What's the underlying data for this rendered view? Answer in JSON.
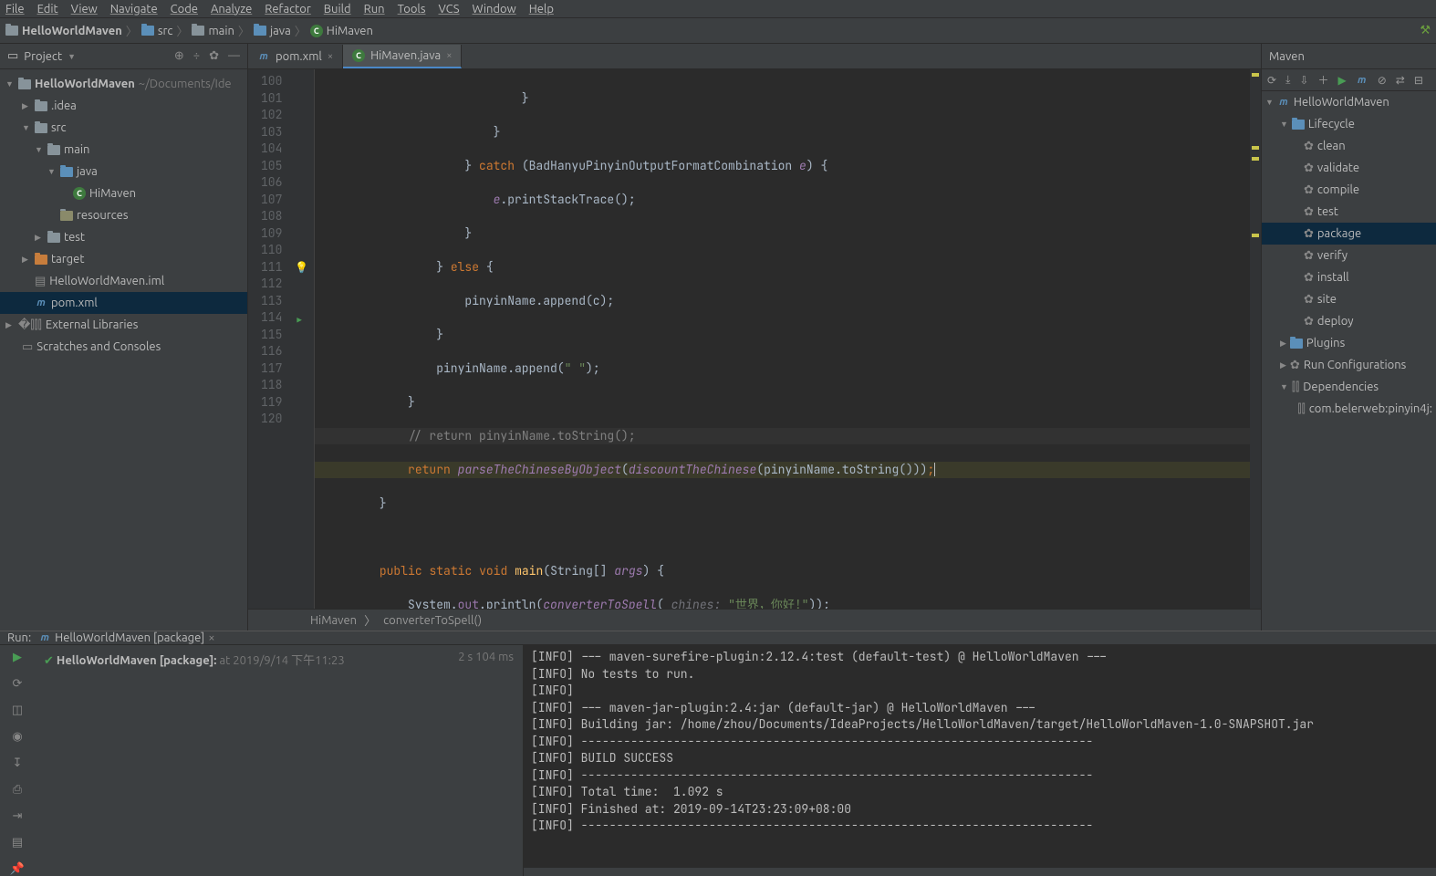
{
  "menu": [
    "File",
    "Edit",
    "View",
    "Navigate",
    "Code",
    "Analyze",
    "Refactor",
    "Build",
    "Run",
    "Tools",
    "VCS",
    "Window",
    "Help"
  ],
  "breadcrumbs": {
    "root": "HelloWorldMaven",
    "items": [
      "src",
      "main",
      "java",
      "HiMaven"
    ]
  },
  "project_panel": {
    "title": "Project",
    "root": "HelloWorldMaven",
    "root_path": "~/Documents/Ide",
    "idea": ".idea",
    "src": "src",
    "main": "main",
    "java": "java",
    "himaven": "HiMaven",
    "resources": "resources",
    "test": "test",
    "target": "target",
    "iml": "HelloWorldMaven.iml",
    "pom": "pom.xml",
    "ext_libs": "External Libraries",
    "scratches": "Scratches and Consoles"
  },
  "tabs": {
    "pom": "pom.xml",
    "himaven": "HiMaven.java"
  },
  "code_lines_start": 100,
  "editor_breadcrumb_class": "HiMaven",
  "editor_breadcrumb_method": "converterToSpell()",
  "maven": {
    "title": "Maven",
    "root": "HelloWorldMaven",
    "lifecycle": "Lifecycle",
    "goals": [
      "clean",
      "validate",
      "compile",
      "test",
      "package",
      "verify",
      "install",
      "site",
      "deploy"
    ],
    "selected_goal": "package",
    "plugins": "Plugins",
    "run_cfg": "Run Configurations",
    "deps": "Dependencies",
    "dep_item": "com.belerweb:pinyin4j:"
  },
  "run": {
    "header_label": "Run:",
    "tab_label": "HelloWorldMaven [package]",
    "task_label": "HelloWorldMaven [package]:",
    "task_time": "at 2019/9/14 下午11:23",
    "duration": "2 s 104 ms",
    "output": [
      "[INFO] --- maven-surefire-plugin:2.12.4:test (default-test) @ HelloWorldMaven ---",
      "[INFO] No tests to run.",
      "[INFO]",
      "[INFO] --- maven-jar-plugin:2.4:jar (default-jar) @ HelloWorldMaven ---",
      "[INFO] Building jar: /home/zhou/Documents/IdeaProjects/HelloWorldMaven/target/HelloWorldMaven-1.0-SNAPSHOT.jar",
      "[INFO] ------------------------------------------------------------------------",
      "[INFO] BUILD SUCCESS",
      "[INFO] ------------------------------------------------------------------------",
      "[INFO] Total time:  1.092 s",
      "[INFO] Finished at: 2019-09-14T23:23:09+08:00",
      "[INFO] ------------------------------------------------------------------------"
    ]
  }
}
